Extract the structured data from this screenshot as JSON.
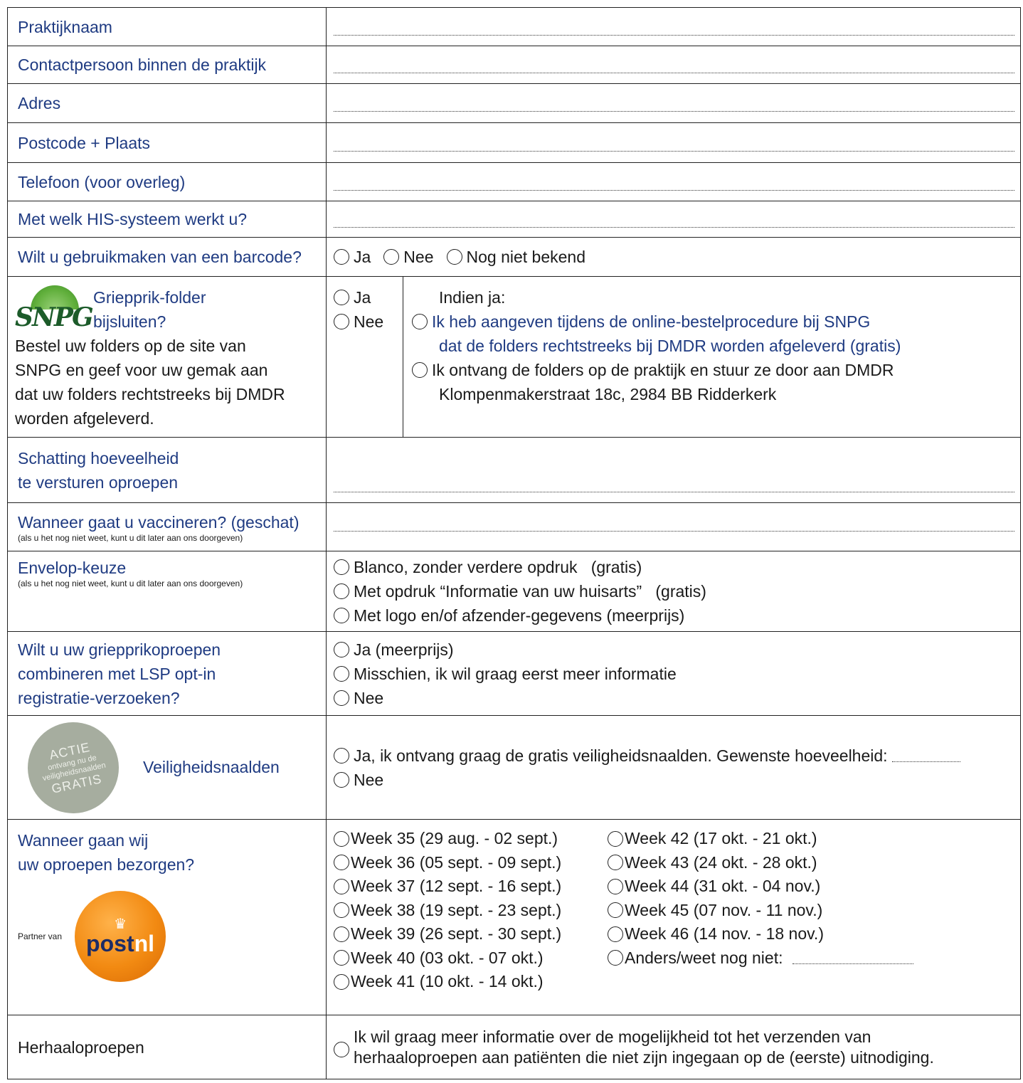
{
  "rows": {
    "praktijknaam": "Praktijknaam",
    "contactpersoon": "Contactpersoon binnen de praktijk",
    "adres": "Adres",
    "postcode": "Postcode + Plaats",
    "telefoon": "Telefoon (voor overleg)",
    "his": "Met welk HIS-systeem werkt u?",
    "barcode": "Wilt u gebruikmaken van een barcode?"
  },
  "barcode_options": [
    "Ja",
    "Nee",
    "Nog niet bekend"
  ],
  "griep": {
    "logo_text": "SNPG",
    "title_line1": "Griepprik-folder",
    "title_line2": "bijsluiten?",
    "desc_lines": [
      "Bestel uw folders op de site van",
      "SNPG en geef voor uw gemak aan",
      "dat uw folders rechtstreeks bij DMDR",
      "worden afgeleverd."
    ],
    "yes": "Ja",
    "no": "Nee",
    "indien": "Indien ja:",
    "opt1_line1": "Ik heb aangeven tijdens de online-bestelprocedure bij SNPG",
    "opt1_line2": "dat de folders rechtstreeks bij DMDR worden afgeleverd (gratis)",
    "opt2_line1": "Ik ontvang de folders op de praktijk en stuur ze door aan DMDR",
    "opt2_line2": "Klompenmakerstraat 18c, 2984 BB Ridderkerk"
  },
  "schatting": {
    "line1": "Schatting hoeveelheid",
    "line2": "te versturen oproepen"
  },
  "vaccineren": {
    "title": "Wanneer gaat u vaccineren? (geschat)",
    "note": "(als u het nog niet weet, kunt u dit later aan ons doorgeven)"
  },
  "envelop": {
    "title": "Envelop-keuze",
    "note": "(als u het nog niet weet, kunt u dit later aan ons doorgeven)",
    "options": [
      "Blanco, zonder verdere opdruk   (gratis)",
      "Met opdruk “Informatie van uw huisarts”   (gratis)",
      "Met logo en/of afzender-gegevens (meerprijs)"
    ]
  },
  "lsp": {
    "lines": [
      "Wilt u uw griepprikoproepen",
      "combineren met LSP opt-in",
      "registratie-verzoeken?"
    ],
    "options": [
      "Ja (meerprijs)",
      "Misschien, ik wil graag eerst meer informatie",
      "Nee"
    ]
  },
  "naalden": {
    "badge_top": "ACTIE",
    "badge_mid1": "ontvang nu de",
    "badge_mid2": "veiligheidsnaalden",
    "badge_bottom": "GRATIS",
    "title": "Veiligheidsnaalden",
    "yes": "Ja, ik ontvang graag de gratis veiligheidsnaalden. Gewenste hoeveelheid:",
    "no": "Nee"
  },
  "bezorgen": {
    "line1": "Wanneer gaan wij",
    "line2": "uw oproepen bezorgen?",
    "partner": "Partner van",
    "postnl_a": "post",
    "postnl_b": "nl",
    "weeks_left": [
      "Week 35 (29 aug. - 02 sept.)",
      "Week 36 (05 sept. - 09 sept.)",
      "Week 37 (12 sept. - 16 sept.)",
      "Week 38 (19 sept. - 23 sept.)",
      "Week 39 (26 sept. - 30 sept.)",
      "Week 40 (03 okt. - 07 okt.)",
      "Week 41 (10 okt. - 14 okt.)"
    ],
    "weeks_right": [
      "Week 42 (17 okt. - 21 okt.)",
      "Week 43 (24 okt. - 28 okt.)",
      "Week 44 (31 okt. - 04 nov.)",
      "Week 45 (07 nov. - 11 nov.)",
      "Week 46 (14 nov. - 18 nov.)",
      "Anders/weet nog niet:"
    ]
  },
  "herhaal": {
    "title": "Herhaaloproepen",
    "line1": "Ik wil graag meer informatie over de mogelijkheid tot het verzenden van",
    "line2": "herhaaloproepen aan patiënten die niet zijn ingegaan op de (eerste) uitnodiging."
  }
}
